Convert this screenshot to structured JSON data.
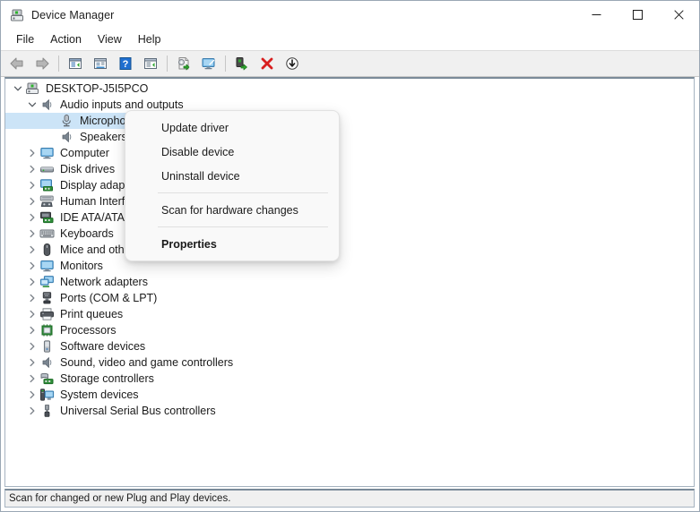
{
  "window": {
    "title": "Device Manager",
    "icon": "device-manager-icon",
    "caption_buttons": [
      {
        "name": "minimize-button",
        "glyph": "minimize"
      },
      {
        "name": "maximize-button",
        "glyph": "maximize"
      },
      {
        "name": "close-button",
        "glyph": "close"
      }
    ]
  },
  "menubar": {
    "items": [
      {
        "name": "menu-file",
        "label": "File"
      },
      {
        "name": "menu-action",
        "label": "Action"
      },
      {
        "name": "menu-view",
        "label": "View"
      },
      {
        "name": "menu-help",
        "label": "Help"
      }
    ]
  },
  "toolbar": {
    "buttons": [
      {
        "name": "back-button",
        "icon": "back-arrow-icon"
      },
      {
        "name": "forward-button",
        "icon": "forward-arrow-icon"
      },
      {
        "name": "separator-1",
        "icon": "separator"
      },
      {
        "name": "show-hide-console-tree-button",
        "icon": "console-tree-icon"
      },
      {
        "name": "properties-button",
        "icon": "properties-window-icon"
      },
      {
        "name": "help-button",
        "icon": "help-question-icon"
      },
      {
        "name": "update-driver-button",
        "icon": "update-driver-icon"
      },
      {
        "name": "separator-2",
        "icon": "separator"
      },
      {
        "name": "scan-for-hardware-changes-button",
        "icon": "scan-hardware-icon"
      },
      {
        "name": "display-button",
        "icon": "monitor-icon"
      },
      {
        "name": "separator-3",
        "icon": "separator"
      },
      {
        "name": "disable-device-button",
        "icon": "disable-device-icon"
      },
      {
        "name": "uninstall-device-button",
        "icon": "red-x-icon"
      },
      {
        "name": "download-button",
        "icon": "download-arrow-icon"
      }
    ]
  },
  "tree": {
    "nodes": [
      {
        "name": "tree-node-desktop",
        "label": "DESKTOP-J5I5PCO",
        "level": 0,
        "state": "expanded",
        "icon": "computer-root-icon",
        "selected": false
      },
      {
        "name": "tree-node-audio",
        "label": "Audio inputs and outputs",
        "level": 1,
        "state": "expanded",
        "icon": "speaker-icon",
        "selected": false
      },
      {
        "name": "tree-node-microphone",
        "label": "Microphone (Realtek Audio)",
        "level": 2,
        "state": "leaf",
        "icon": "microphone-device-icon",
        "selected": true
      },
      {
        "name": "tree-node-speakers",
        "label": "Speakers (Realtek Audio)",
        "level": 2,
        "state": "leaf",
        "icon": "speaker-icon",
        "selected": false
      },
      {
        "name": "tree-node-computer",
        "label": "Computer",
        "level": 1,
        "state": "collapsed",
        "icon": "monitor-icon",
        "selected": false
      },
      {
        "name": "tree-node-disk-drives",
        "label": "Disk drives",
        "level": 1,
        "state": "collapsed",
        "icon": "disk-drive-icon",
        "selected": false
      },
      {
        "name": "tree-node-display",
        "label": "Display adapters",
        "level": 1,
        "state": "collapsed",
        "icon": "display-adapter-icon",
        "selected": false
      },
      {
        "name": "tree-node-hid",
        "label": "Human Interface Devices",
        "level": 1,
        "state": "collapsed",
        "icon": "hid-icon",
        "selected": false
      },
      {
        "name": "tree-node-ide",
        "label": "IDE ATA/ATAPI controllers",
        "level": 1,
        "state": "collapsed",
        "icon": "ide-controller-icon",
        "selected": false
      },
      {
        "name": "tree-node-keyboards",
        "label": "Keyboards",
        "level": 1,
        "state": "collapsed",
        "icon": "keyboard-icon",
        "selected": false
      },
      {
        "name": "tree-node-mice",
        "label": "Mice and other pointing devices",
        "level": 1,
        "state": "collapsed",
        "icon": "mouse-icon",
        "selected": false
      },
      {
        "name": "tree-node-monitors",
        "label": "Monitors",
        "level": 1,
        "state": "collapsed",
        "icon": "monitor-icon",
        "selected": false
      },
      {
        "name": "tree-node-network",
        "label": "Network adapters",
        "level": 1,
        "state": "collapsed",
        "icon": "network-adapter-icon",
        "selected": false
      },
      {
        "name": "tree-node-ports",
        "label": "Ports (COM & LPT)",
        "level": 1,
        "state": "collapsed",
        "icon": "port-icon",
        "selected": false
      },
      {
        "name": "tree-node-print-queues",
        "label": "Print queues",
        "level": 1,
        "state": "collapsed",
        "icon": "printer-icon",
        "selected": false
      },
      {
        "name": "tree-node-processors",
        "label": "Processors",
        "level": 1,
        "state": "collapsed",
        "icon": "processor-icon",
        "selected": false
      },
      {
        "name": "tree-node-software",
        "label": "Software devices",
        "level": 1,
        "state": "collapsed",
        "icon": "software-device-icon",
        "selected": false
      },
      {
        "name": "tree-node-sound",
        "label": "Sound, video and game controllers",
        "level": 1,
        "state": "collapsed",
        "icon": "speaker-icon",
        "selected": false
      },
      {
        "name": "tree-node-storage",
        "label": "Storage controllers",
        "level": 1,
        "state": "collapsed",
        "icon": "storage-controller-icon",
        "selected": false
      },
      {
        "name": "tree-node-system",
        "label": "System devices",
        "level": 1,
        "state": "collapsed",
        "icon": "system-device-icon",
        "selected": false
      },
      {
        "name": "tree-node-usb",
        "label": "Universal Serial Bus controllers",
        "level": 1,
        "state": "collapsed",
        "icon": "usb-icon",
        "selected": false
      }
    ]
  },
  "context_menu": {
    "items": [
      {
        "name": "context-menu-update-driver",
        "label": "Update driver",
        "bold": false
      },
      {
        "name": "context-menu-disable-device",
        "label": "Disable device",
        "bold": false
      },
      {
        "name": "context-menu-uninstall-device",
        "label": "Uninstall device",
        "bold": false
      },
      {
        "name": "context-menu-separator-1",
        "label": "",
        "separator": true
      },
      {
        "name": "context-menu-scan-hardware",
        "label": "Scan for hardware changes",
        "bold": false
      },
      {
        "name": "context-menu-separator-2",
        "label": "",
        "separator": true
      },
      {
        "name": "context-menu-properties",
        "label": "Properties",
        "bold": true
      }
    ]
  },
  "statusbar": {
    "text": "Scan for changed or new Plug and Play devices.",
    "pane2": "",
    "pane3": ""
  },
  "colors": {
    "selection": "#cce4f7",
    "toolbar_bg": "#f0f0f0",
    "menu_bg": "#f9f9f9",
    "accent_red": "#d81f1f",
    "accent_blue": "#1f6fd0",
    "accent_green": "#31a82b"
  }
}
